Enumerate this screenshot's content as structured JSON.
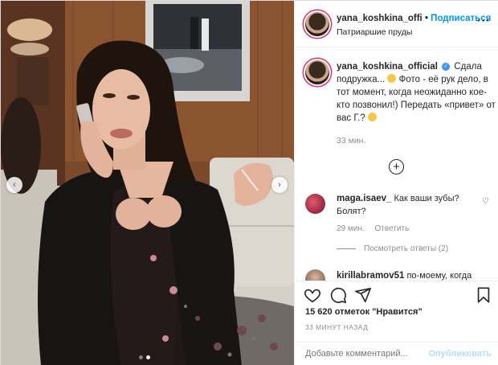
{
  "post": {
    "username": "yana_koshkina_offi",
    "follow_label": "Подписаться",
    "separator": "•",
    "location": "Патриаршие пруды",
    "more_label": "···"
  },
  "caption": {
    "username": "yana_koshkina_official",
    "text": "Сдала подружка...",
    "text2": "Фото - её рук дело, в тот момент, когда неожиданно кое-кто позвонил!) Передать «привет» от вас Г.?",
    "time": "33 мин."
  },
  "comments": [
    {
      "username": "maga.isaev_",
      "text": "Как ваши зубы? Болят?",
      "time": "29 мин.",
      "reply_label": "Ответить",
      "view_replies": "Посмотреть ответы (2)"
    },
    {
      "username": "kirillabramov51",
      "text": "по-моему, когда"
    }
  ],
  "likes": "15 620 отметок \"Нравится\"",
  "time_ago": "33 МИНУТ НАЗАД",
  "composer": {
    "placeholder": "Добавьте комментарий...",
    "post_label": "Опубликовать"
  },
  "carousel": {
    "current": 2,
    "total": 2
  },
  "icons": [
    "heart-icon",
    "comment-icon",
    "share-icon",
    "bookmark-icon",
    "plus-circle-icon",
    "chevron-left-icon",
    "chevron-right-icon",
    "verified-icon"
  ],
  "colors": {
    "accent": "#0095f6",
    "muted": "#8e8e8e",
    "story_ring": "#e1306c"
  }
}
